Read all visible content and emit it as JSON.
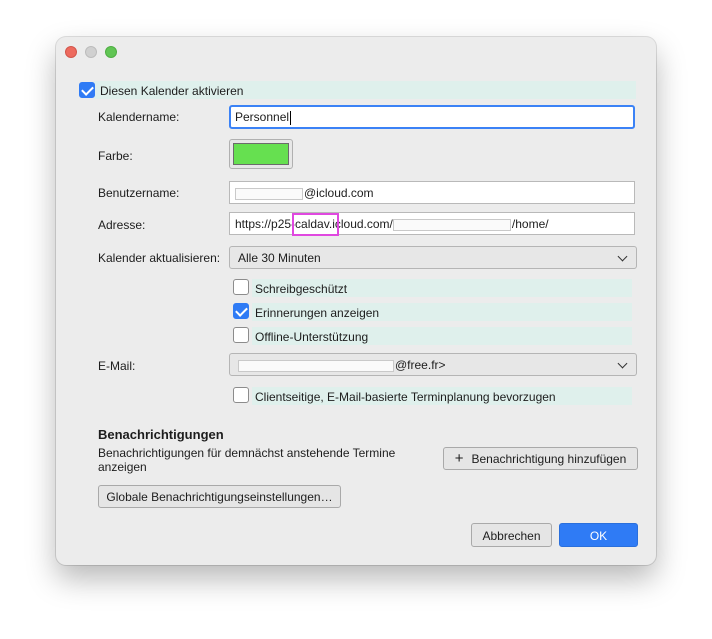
{
  "colors": {
    "accent": "#2f7bf5",
    "calendar_color": "#66e050",
    "annotation": "#e048e0",
    "highlight": "#dff0ec"
  },
  "enable": {
    "label": "Diesen Kalender aktivieren",
    "checked": true
  },
  "calendar_name": {
    "label": "Kalendername:",
    "value": "Personnel"
  },
  "color": {
    "label": "Farbe:"
  },
  "username": {
    "label": "Benutzername:",
    "suffix": "@icloud.com"
  },
  "address": {
    "label": "Adresse:",
    "part1": "https://p25",
    "part2": "-caldav.",
    "part3": "icloud.com/",
    "part4": "/home/"
  },
  "refresh": {
    "label": "Kalender aktualisieren:",
    "value": "Alle 30 Minuten"
  },
  "options": [
    {
      "label": "Schreibgeschützt",
      "checked": false
    },
    {
      "label": "Erinnerungen anzeigen",
      "checked": true
    },
    {
      "label": "Offline-Unterstützung",
      "checked": false
    }
  ],
  "email": {
    "label": "E-Mail:",
    "suffix": "@free.fr>"
  },
  "client_scheduling": {
    "label": "Clientseitige, E-Mail-basierte Terminplanung bevorzugen",
    "checked": false
  },
  "notifications": {
    "title": "Benachrichtigungen",
    "description": "Benachrichtigungen für demnächst anstehende Termine anzeigen",
    "add_button": "Benachrichtigung hinzufügen",
    "add_icon": "plus-icon",
    "global_button": "Globale Benachrichtigungseinstellungen…"
  },
  "buttons": {
    "cancel": "Abbrechen",
    "ok": "OK"
  }
}
